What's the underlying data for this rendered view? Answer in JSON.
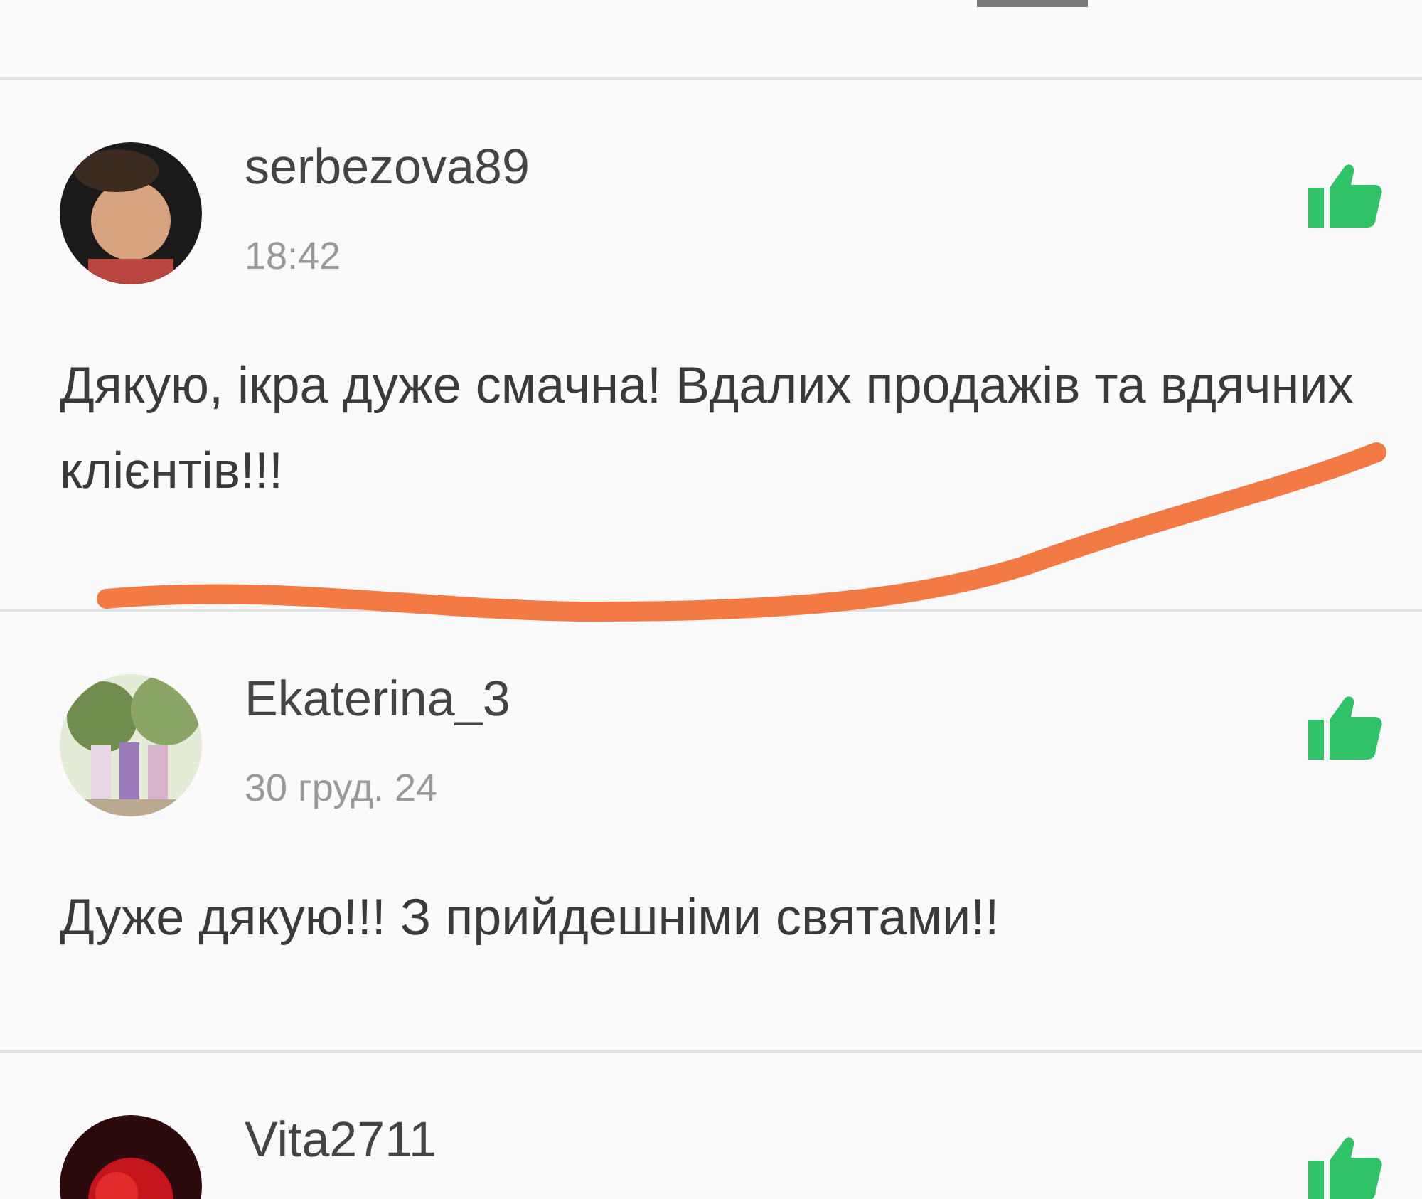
{
  "reviews": [
    {
      "author": "serbezova89",
      "time": "18:42",
      "text": "Дякую, ікра дуже смачна! Вдалих продажів та вдячних клієнтів!!!",
      "liked": true
    },
    {
      "author": "Ekaterina_3",
      "time": "30 груд. 24",
      "text": "Дуже дякую!!! З прийдешніми святами!!",
      "liked": true
    },
    {
      "author": "Vita2711",
      "liked": true
    }
  ]
}
